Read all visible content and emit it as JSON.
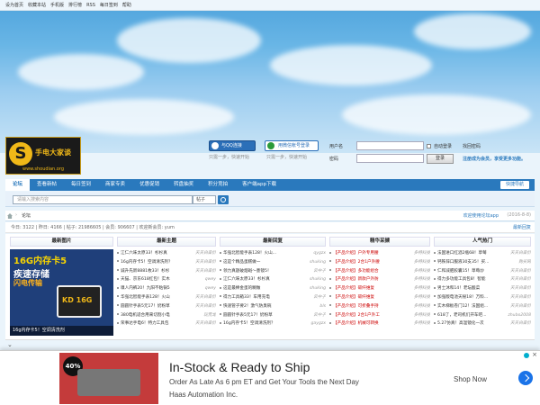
{
  "topbar": {
    "links": [
      "设为首页",
      "收藏本站",
      "手机版",
      "排行榜",
      "RSS",
      "每日签到",
      "帮助"
    ]
  },
  "logo": {
    "letter": "S",
    "name": "手电大家谈",
    "url": "www.shoudian.org"
  },
  "social": {
    "qq_label": "与QQ连接",
    "wx_label": "用微信帐号登录",
    "qq_hint": "只需一步，快速开始",
    "wx_hint": "只需一步，快速开始"
  },
  "login": {
    "user_label": "用户名",
    "pass_label": "密码",
    "auto_login": "自动登录",
    "find_pwd": "找回密码",
    "submit": "登录",
    "register": "注册成为会员，享受更多功能。"
  },
  "nav": {
    "items": [
      "论坛",
      "查看新帖",
      "每日签到",
      "商家专卖",
      "优惠促销",
      "转盘抽奖",
      "积分竞拍",
      "客户端app下载"
    ],
    "quick": "快捷导航"
  },
  "search": {
    "placeholder": "请输入搜索内容",
    "type": "帖子"
  },
  "crumb": {
    "current": "论坛",
    "welcome": "欢迎使用论坛app",
    "date": "(2016-8-8)"
  },
  "stats": {
    "text": "今日: 3122  |  昨日: 4166  |  帖子: 21986605  |  会员: 906607  |  欢迎新会员: yum",
    "right": "最新回复"
  },
  "columns": {
    "headers": [
      "最新图片",
      "最新主题",
      "最新回复",
      "精华采撷",
      "人气热门"
    ]
  },
  "promo": {
    "line1": "16G内存卡5",
    "line2": "疾速存储",
    "line3": "闪电传输",
    "card": "KD 16G",
    "caption": "16g内存卡5！空调清洗剂"
  },
  "lists": {
    "latest_topics": [
      {
        "title": "江仁六味太原33！杉杉真",
        "by": "天天白菜价"
      },
      {
        "title": "16g内存卡5！空调清洗剂？",
        "by": "天天白菜价"
      },
      {
        "title": "诚升先新8881枚33！杉杉",
        "by": "天天白菜价"
      },
      {
        "title": "天猫、京东618红包！实木",
        "by": "qwey"
      },
      {
        "title": "嗅人内裤20！九阳不粘锅5",
        "by": "qwey"
      },
      {
        "title": "华强北智能手表128！火山",
        "by": "天天白菜价"
      },
      {
        "title": "圆圆针手表5元17！奶粉草",
        "by": "天天白菜价"
      },
      {
        "title": "380电机适合用来切割小电",
        "by": "玩荒龙"
      },
      {
        "title": "荣事达手电6！特力工具包",
        "by": "天天白菜价"
      }
    ],
    "latest_replies": [
      {
        "title": "华强北智能手表128！火山...",
        "by": "qygzx"
      },
      {
        "title": "这是个精品蛋糕做一",
        "by": "shuking"
      },
      {
        "title": "领力真题破烟斑～墨镜5！",
        "by": "云中子"
      },
      {
        "title": "江仁六味太原33！杉杉真",
        "by": "shuking"
      },
      {
        "title": "这是最棒金蛋的糊做",
        "by": "shuking"
      },
      {
        "title": "得力工具箱33！车用充电",
        "by": "云中子"
      },
      {
        "title": "快速管子要2！激气防臭碗",
        "by": "bls"
      },
      {
        "title": "圆圆针手表5元17！奶粉草",
        "by": "云中子"
      },
      {
        "title": "16g内存卡5！空调清洗剂？",
        "by": "gaygzx"
      }
    ],
    "featured": [
      {
        "title": "【产品介绍】户外专用腰",
        "by": "多特科技"
      },
      {
        "title": "【产品介绍】2合1户外腰",
        "by": "多特科技"
      },
      {
        "title": "【产品介绍】多功能组合",
        "by": "多特科技"
      },
      {
        "title": "【产品介绍】新款户外防",
        "by": "多特科技"
      },
      {
        "title": "【产品介绍】碳纤维复",
        "by": "多特科技"
      },
      {
        "title": "【产品介绍】碳纤维复",
        "by": "多特科技"
      },
      {
        "title": "【产品介绍】可折叠手持",
        "by": "多特科技"
      },
      {
        "title": "【产品介绍】2合1户外工",
        "by": "多特科技"
      },
      {
        "title": "【产品介绍】机械可转换",
        "by": "多特科技"
      }
    ],
    "popular": [
      {
        "title": "法国进口红酒2瓶68！草莓",
        "by": "天天白菜价"
      },
      {
        "title": "钙铁锌口服液30支35！买...",
        "by": "购买网"
      },
      {
        "title": "仁和减肥胶囊15！草莓炒",
        "by": "天天白菜价"
      },
      {
        "title": "得力多功能工具包8！智能",
        "by": "天天白菜价"
      },
      {
        "title": "男士沐和14！老坛酸菜",
        "by": "天天白菜价"
      },
      {
        "title": "加强版电池天秘18！万料...",
        "by": "天天白菜价"
      },
      {
        "title": "实木梯板卷门12！法国组...",
        "by": "天天白菜价"
      },
      {
        "title": "618了，老司机们开车吧...",
        "by": "zhubo2008"
      },
      {
        "title": "5.27仿真！高温镜化一次",
        "by": "天天白菜价"
      }
    ]
  },
  "ad": {
    "headline": "In-Stock & Ready to Ship",
    "sub": "Order As Late As 6 pm ET and Get Your Tools the Next Day",
    "brand": "Haas Automation Inc.",
    "shop": "Shop Now",
    "tag": "40%"
  },
  "colors": {
    "nav": "#2a79bd",
    "accent_red": "#c00",
    "ad_blue": "#1a73e8"
  }
}
